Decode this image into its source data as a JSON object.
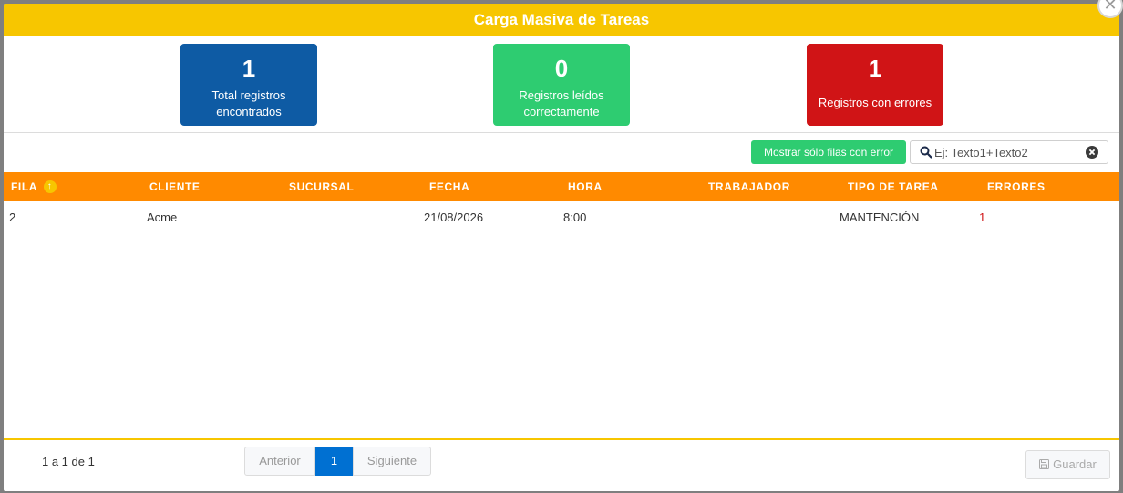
{
  "modal": {
    "title": "Carga Masiva de Tareas",
    "close_icon": "close-icon"
  },
  "stats": [
    {
      "value": "1",
      "label": "Total registros encontrados",
      "color": "#0e5ba4"
    },
    {
      "value": "0",
      "label": "Registros leídos correctamente",
      "color": "#2ecc71"
    },
    {
      "value": "1",
      "label": "Registros con errores",
      "color": "#d01416"
    }
  ],
  "toolbar": {
    "error_filter_label": "Mostrar sólo filas con error",
    "search_placeholder": "Ej: Texto1+Texto2",
    "search_value": ""
  },
  "table": {
    "columns": [
      "FILA",
      "CLIENTE",
      "SUCURSAL",
      "FECHA",
      "HORA",
      "TRABAJADOR",
      "TIPO DE TAREA",
      "ERRORES"
    ],
    "rows": [
      [
        "2",
        "Acme",
        "",
        "21/08/2026",
        "8:00",
        "",
        "MANTENCIÓN",
        "1"
      ]
    ]
  },
  "footer": {
    "range": "1 a 1 de 1",
    "prev_label": "Anterior",
    "current_page": "1",
    "next_label": "Siguiente",
    "save_label": "Guardar"
  },
  "colors": {
    "header": "#f7c600",
    "table_head": "#ff8a00",
    "accent": "#0070d2",
    "error": "#d01416"
  }
}
